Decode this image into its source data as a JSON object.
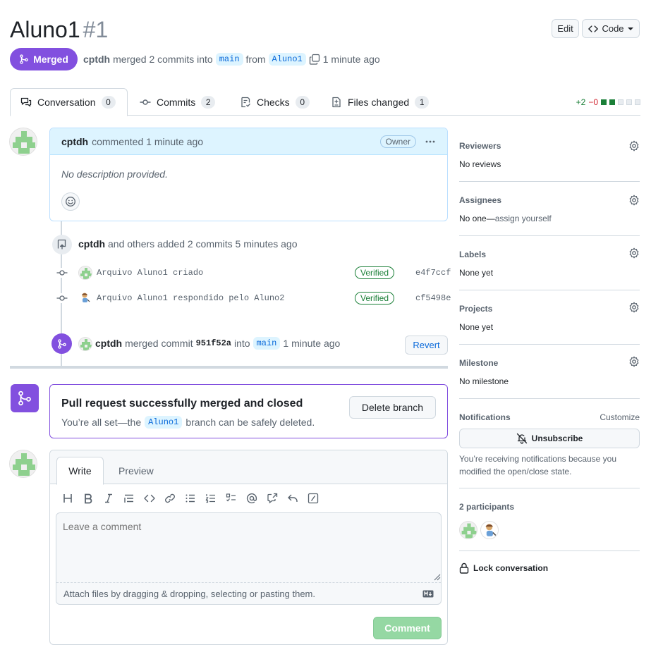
{
  "header": {
    "title": "Aluno1",
    "number": "#1",
    "edit_label": "Edit",
    "code_label": "Code"
  },
  "state": {
    "badge": "Merged",
    "author": "cptdh",
    "text_merged": "merged 2 commits into",
    "base_branch": "main",
    "text_from": "from",
    "head_branch": "Aluno1",
    "time": "1 minute ago"
  },
  "tabs": [
    {
      "label": "Conversation",
      "count": "0",
      "icon": "comment-discussion-icon"
    },
    {
      "label": "Commits",
      "count": "2",
      "icon": "git-commit-icon"
    },
    {
      "label": "Checks",
      "count": "0",
      "icon": "checklist-icon"
    },
    {
      "label": "Files changed",
      "count": "1",
      "icon": "file-diff-icon"
    }
  ],
  "diffstat": {
    "additions": "+2",
    "deletions": "−0"
  },
  "comment": {
    "author": "cptdh",
    "action": "commented 1 minute ago",
    "role_badge": "Owner",
    "body": "No description provided."
  },
  "commits_event": {
    "author": "cptdh",
    "text": "and others added 2 commits 5 minutes ago",
    "commits": [
      {
        "message": "Arquivo Aluno1 criado",
        "verified": "Verified",
        "sha": "e4f7ccf"
      },
      {
        "message": "Arquivo Aluno1 respondido pelo Aluno2",
        "verified": "Verified",
        "sha": "cf5498e"
      }
    ]
  },
  "merge_event": {
    "author": "cptdh",
    "text_merged": "merged commit",
    "sha": "951f52a",
    "text_into": "into",
    "branch": "main",
    "time": "1 minute ago",
    "revert_label": "Revert"
  },
  "merge_box": {
    "title": "Pull request successfully merged and closed",
    "text_before": "You’re all set—the",
    "branch": "Aluno1",
    "text_after": "branch can be safely deleted.",
    "delete_label": "Delete branch"
  },
  "composer": {
    "tab_write": "Write",
    "tab_preview": "Preview",
    "placeholder": "Leave a comment",
    "attach_text": "Attach files by dragging & dropping, selecting or pasting them.",
    "submit_label": "Comment",
    "toolbar": [
      "heading-icon",
      "bold-icon",
      "italic-icon",
      "quote-icon",
      "code-icon",
      "link-icon",
      "unordered-list-icon",
      "ordered-list-icon",
      "task-list-icon",
      "mention-icon",
      "cross-reference-icon",
      "reply-icon",
      "slash-command-icon"
    ]
  },
  "sidebar": {
    "reviewers": {
      "label": "Reviewers",
      "value": "No reviews"
    },
    "assignees": {
      "label": "Assignees",
      "value_prefix": "No one—",
      "value_link": "assign yourself"
    },
    "labels": {
      "label": "Labels",
      "value": "None yet"
    },
    "projects": {
      "label": "Projects",
      "value": "None yet"
    },
    "milestone": {
      "label": "Milestone",
      "value": "No milestone"
    },
    "notifications": {
      "label": "Notifications",
      "customize": "Customize",
      "button": "Unsubscribe",
      "reason": "You’re receiving notifications because you modified the open/close state."
    },
    "participants": {
      "label": "2 participants"
    },
    "lock": {
      "label": "Lock conversation"
    }
  },
  "colors": {
    "merged": "#8250df",
    "accent": "#0969da",
    "success": "#1a7f37",
    "button_success_disabled": "#95d8a3"
  }
}
